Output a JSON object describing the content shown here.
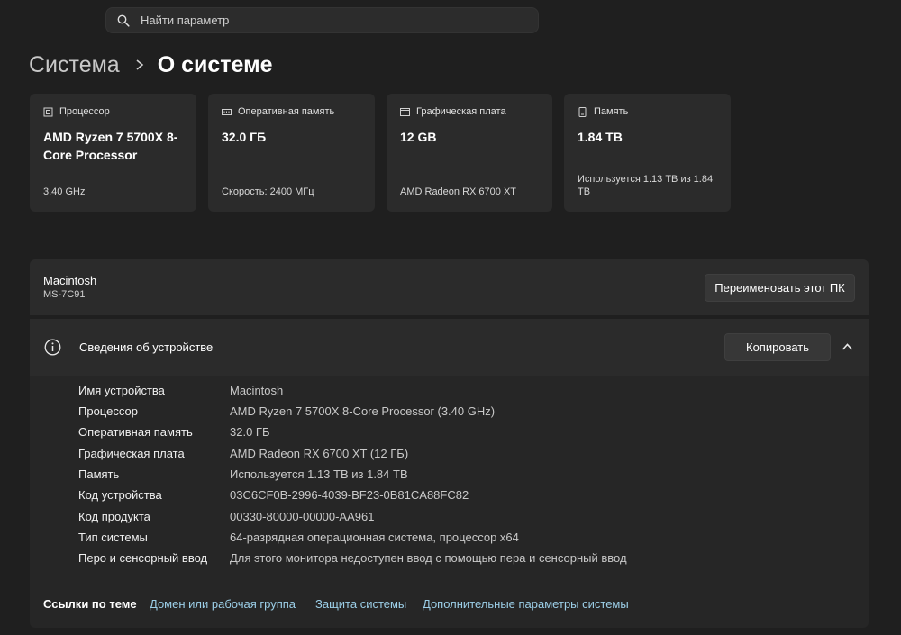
{
  "search": {
    "placeholder": "Найти параметр"
  },
  "breadcrumb": {
    "parent": "Система",
    "current": "О системе"
  },
  "cards": [
    {
      "icon": "cpu-icon",
      "title": "Процессор",
      "value": "AMD Ryzen 7 5700X 8-Core Processor",
      "sub": "3.40 GHz"
    },
    {
      "icon": "ram-icon",
      "title": "Оперативная память",
      "value": "32.0 ГБ",
      "sub": "Скорость: 2400 МГц"
    },
    {
      "icon": "gpu-icon",
      "title": "Графическая плата",
      "value": "12 GB",
      "sub": "AMD Radeon RX 6700 XT"
    },
    {
      "icon": "storage-icon",
      "title": "Память",
      "value": "1.84 TB",
      "sub": "Используется 1.13 TB из 1.84 TB"
    }
  ],
  "device": {
    "name": "Macintosh",
    "model": "MS-7C91",
    "rename_label": "Переименовать этот ПК"
  },
  "details": {
    "title": "Сведения об устройстве",
    "copy_label": "Копировать",
    "rows": [
      {
        "key": "Имя устройства",
        "value": "Macintosh"
      },
      {
        "key": "Процессор",
        "value": "AMD Ryzen 7 5700X 8-Core Processor (3.40 GHz)"
      },
      {
        "key": "Оперативная память",
        "value": "32.0 ГБ"
      },
      {
        "key": "Графическая плата",
        "value": "AMD Radeon RX 6700 XT (12 ГБ)"
      },
      {
        "key": "Память",
        "value": "Используется 1.13 TB из 1.84 TB"
      },
      {
        "key": "Код устройства",
        "value": "03C6CF0B-2996-4039-BF23-0B81CA88FC82"
      },
      {
        "key": "Код продукта",
        "value": "00330-80000-00000-AA961"
      },
      {
        "key": "Тип системы",
        "value": "64-разрядная операционная система, процессор x64"
      },
      {
        "key": "Перо и сенсорный ввод",
        "value": "Для этого монитора недоступен ввод с помощью пера и сенсорный ввод"
      }
    ]
  },
  "related": {
    "label": "Ссылки по теме",
    "links": [
      "Домен или рабочая группа",
      "Защита системы",
      "Дополнительные параметры системы"
    ]
  },
  "colors": {
    "background": "#1f1f1f",
    "card": "#2b2b2b",
    "link": "#9ccfe8"
  }
}
